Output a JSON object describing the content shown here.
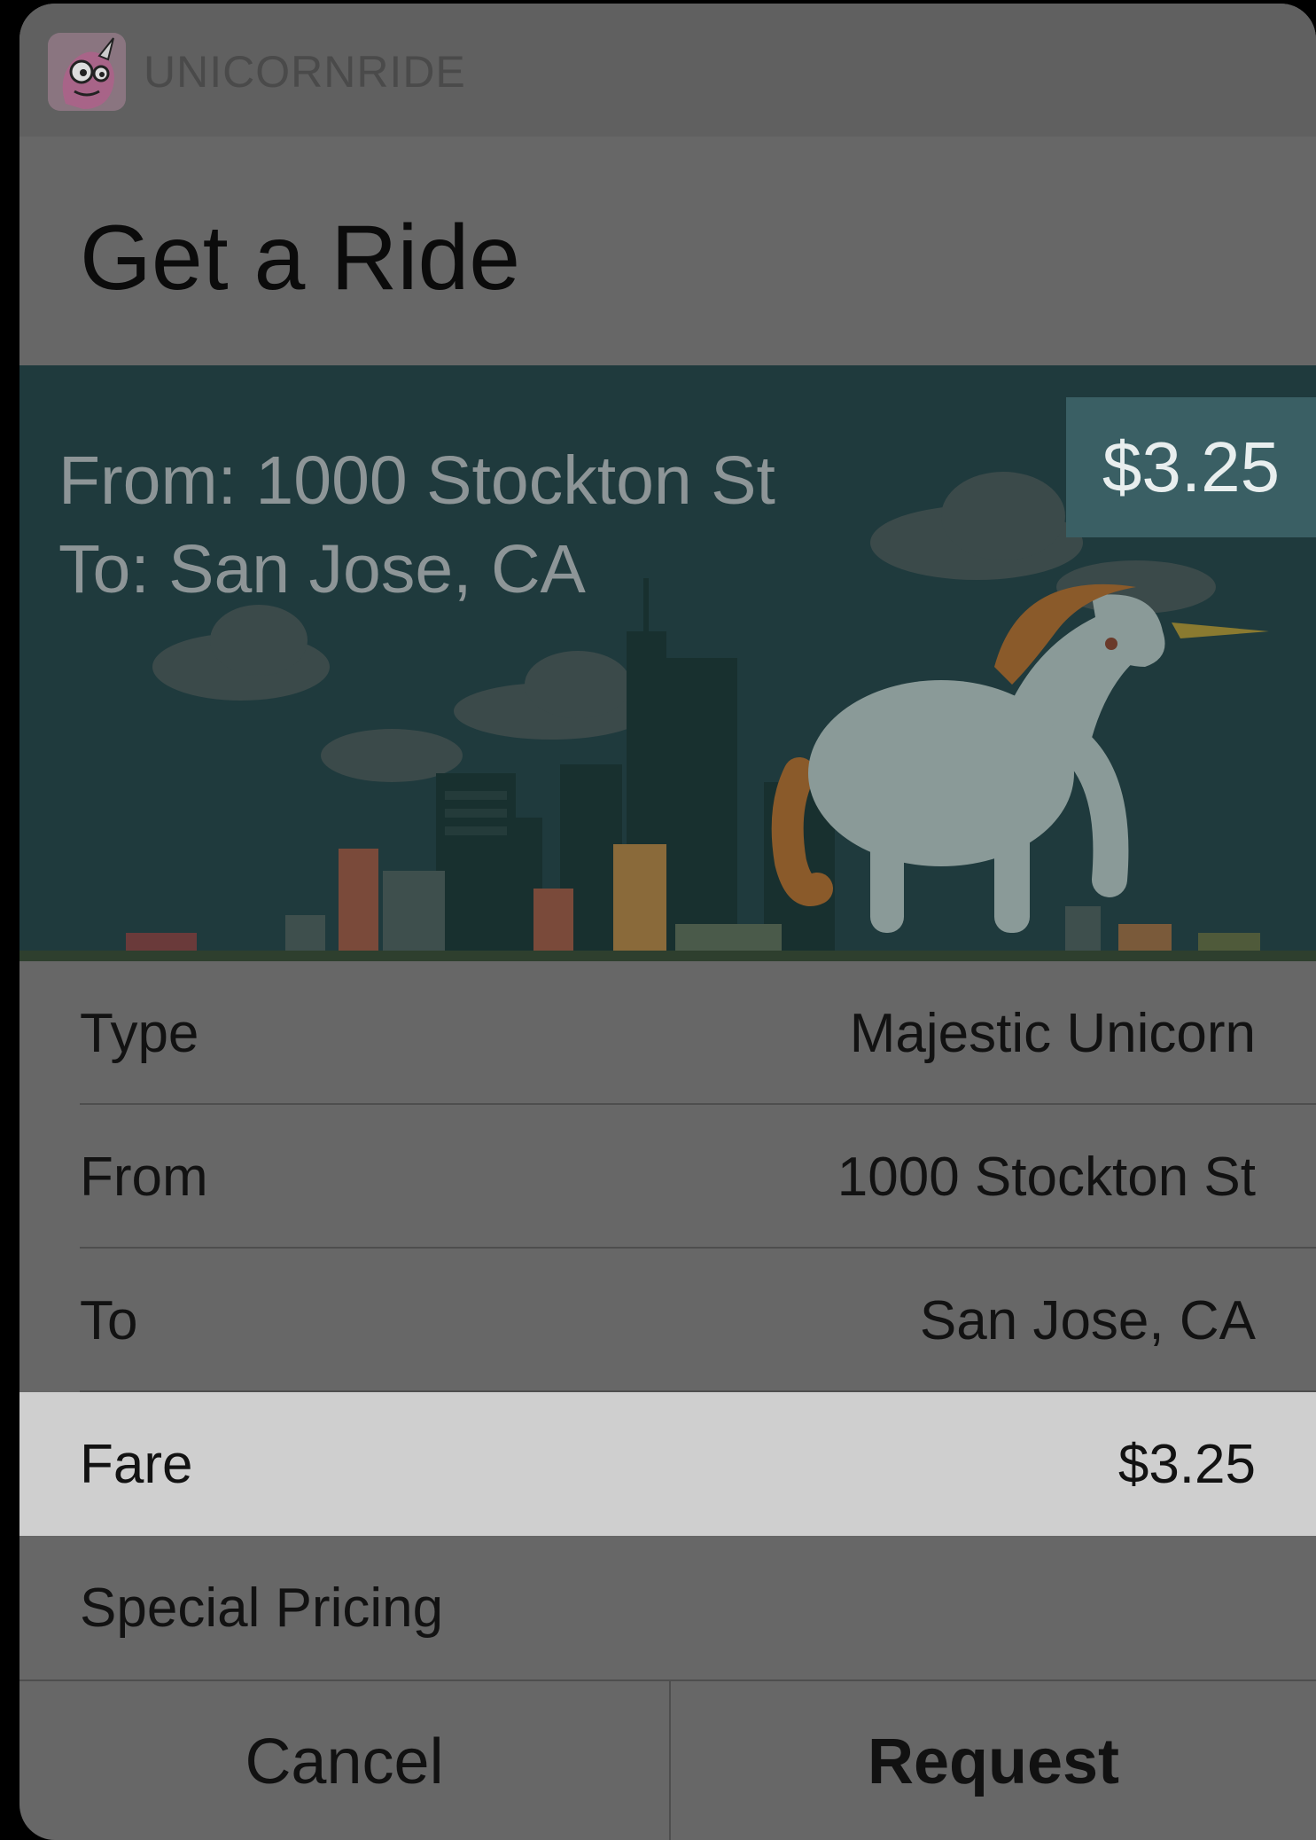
{
  "app": {
    "name": "UNICORNRIDE",
    "icon": "unicorn-logo-icon"
  },
  "title": "Get a Ride",
  "hero": {
    "from_line": "From: 1000 Stockton St",
    "to_line": "To: San Jose, CA",
    "price": "$3.25",
    "illustration": "unicorn-city-illustration"
  },
  "rows": [
    {
      "label": "Type",
      "value": "Majestic Unicorn"
    },
    {
      "label": "From",
      "value": "1000 Stockton St"
    },
    {
      "label": "To",
      "value": "San Jose, CA"
    },
    {
      "label": "Fare",
      "value": "$3.25",
      "selected": true
    },
    {
      "label": "Special Pricing",
      "value": ""
    }
  ],
  "actions": {
    "cancel": "Cancel",
    "request": "Request"
  },
  "colors": {
    "overlay": "#676767",
    "hero_bg": "#1f3a3d",
    "badge": "#3a5f64",
    "selected_row": "#cfcfcf"
  }
}
